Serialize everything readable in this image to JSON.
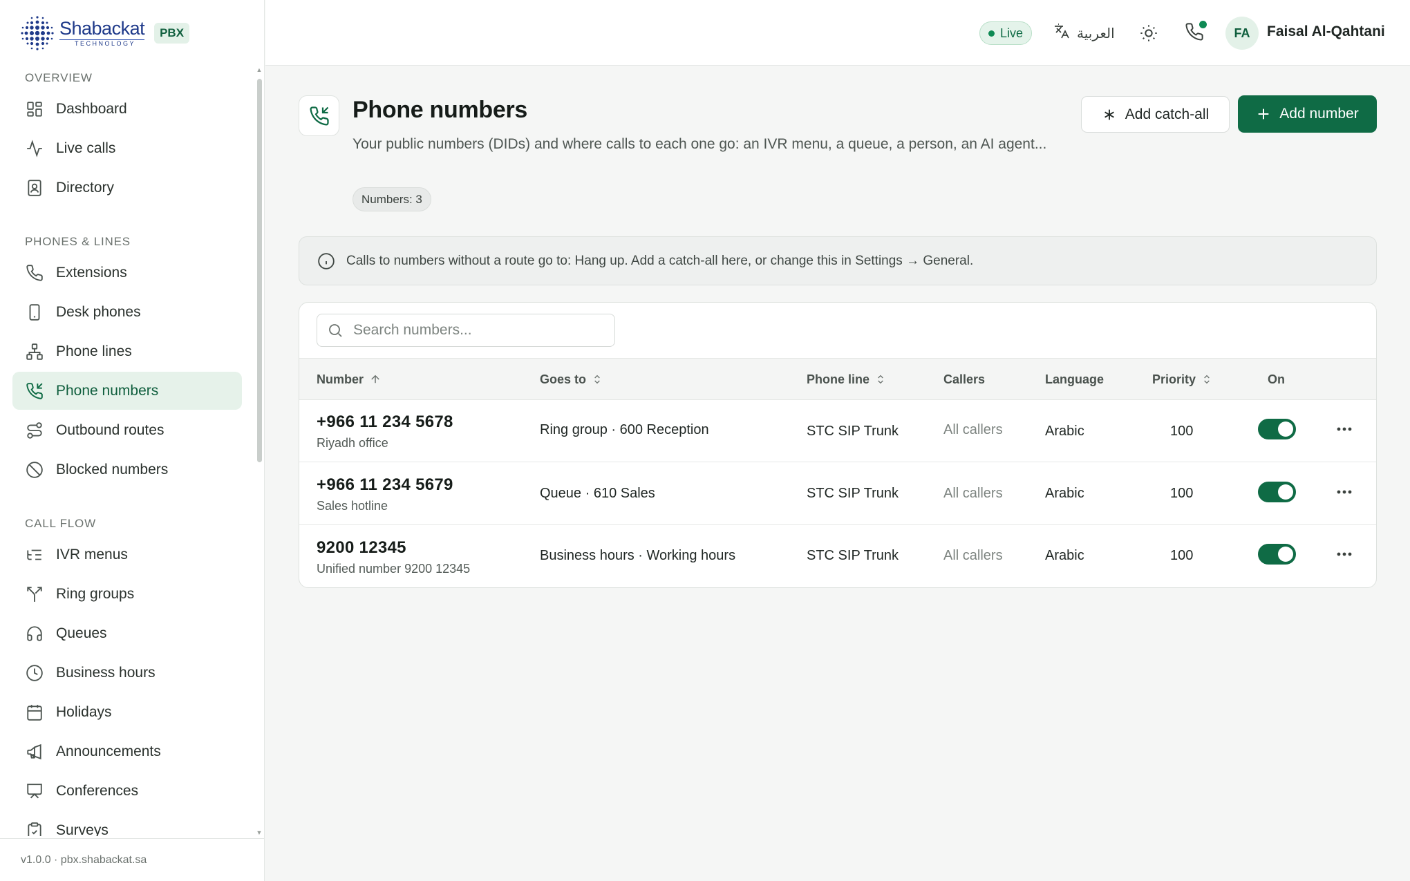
{
  "brand": {
    "name": "Shabackat",
    "sub": "TECHNOLOGY",
    "badge": "PBX"
  },
  "sidebar": {
    "sections": [
      {
        "title": "OVERVIEW",
        "items": [
          {
            "label": "Dashboard",
            "icon": "dashboard-icon"
          },
          {
            "label": "Live calls",
            "icon": "activity-icon"
          },
          {
            "label": "Directory",
            "icon": "contact-book-icon"
          }
        ]
      },
      {
        "title": "PHONES & LINES",
        "items": [
          {
            "label": "Extensions",
            "icon": "phone-icon"
          },
          {
            "label": "Desk phones",
            "icon": "device-icon"
          },
          {
            "label": "Phone lines",
            "icon": "network-icon"
          },
          {
            "label": "Phone numbers",
            "icon": "phone-incoming-icon",
            "active": true
          },
          {
            "label": "Outbound routes",
            "icon": "route-icon"
          },
          {
            "label": "Blocked numbers",
            "icon": "ban-icon"
          }
        ]
      },
      {
        "title": "CALL FLOW",
        "items": [
          {
            "label": "IVR menus",
            "icon": "list-tree-icon"
          },
          {
            "label": "Ring groups",
            "icon": "split-icon"
          },
          {
            "label": "Queues",
            "icon": "headphones-icon"
          },
          {
            "label": "Business hours",
            "icon": "clock-icon"
          },
          {
            "label": "Holidays",
            "icon": "calendar-icon"
          },
          {
            "label": "Announcements",
            "icon": "megaphone-icon"
          },
          {
            "label": "Conferences",
            "icon": "presentation-icon"
          },
          {
            "label": "Surveys",
            "icon": "clipboard-check-icon"
          }
        ]
      }
    ],
    "footer": "v1.0.0 · pbx.shabackat.sa"
  },
  "topbar": {
    "live_label": "Live",
    "language_label": "العربية",
    "avatar_initials": "FA",
    "user_name": "Faisal Al-Qahtani"
  },
  "page": {
    "title": "Phone numbers",
    "description": "Your public numbers (DIDs) and where calls to each one go: an IVR menu, a queue, a person, an AI agent...",
    "count_badge": "Numbers: 3",
    "add_catch_all_label": "Add catch-all",
    "add_number_label": "Add number",
    "banner": "Calls to numbers without a route go to: Hang up. Add a catch-all here, or change this in Settings → General."
  },
  "search": {
    "placeholder": "Search numbers...",
    "value": ""
  },
  "table": {
    "columns": [
      "Number",
      "Goes to",
      "Phone line",
      "Callers",
      "Language",
      "Priority",
      "On"
    ],
    "rows": [
      {
        "number": "+966 11 234 5678",
        "label": "Riyadh office",
        "goes_to": "Ring group · 600 Reception",
        "phone_line": "STC SIP Trunk",
        "callers": "All callers",
        "language": "Arabic",
        "priority": "100",
        "on": true
      },
      {
        "number": "+966 11 234 5679",
        "label": "Sales hotline",
        "goes_to": "Queue · 610 Sales",
        "phone_line": "STC SIP Trunk",
        "callers": "All callers",
        "language": "Arabic",
        "priority": "100",
        "on": true
      },
      {
        "number": "9200 12345",
        "label": "Unified number 9200 12345",
        "goes_to": "Business hours · Working hours",
        "phone_line": "STC SIP Trunk",
        "callers": "All callers",
        "language": "Arabic",
        "priority": "100",
        "on": true
      }
    ]
  },
  "colors": {
    "accent": "#0f6b45",
    "accent_light": "#e6f2ea",
    "live": "#0f8a54"
  }
}
